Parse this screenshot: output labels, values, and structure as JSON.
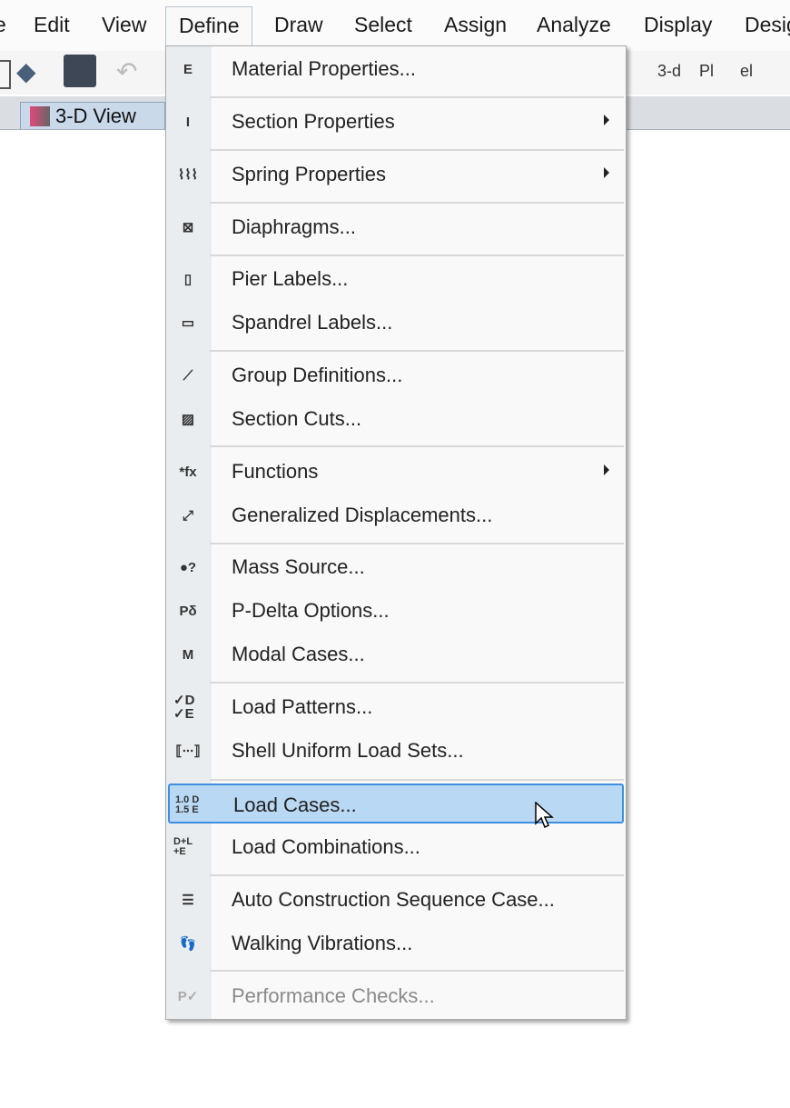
{
  "menubar": [
    "e",
    "Edit",
    "View",
    "Define",
    "Draw",
    "Select",
    "Assign",
    "Analyze",
    "Display",
    "Desig"
  ],
  "toolbar": {
    "view_3d": "3-d",
    "plan": "Pl",
    "elev": "el"
  },
  "tab": {
    "label": "3-D View"
  },
  "define_menu": {
    "items": [
      {
        "label": "Material Properties...",
        "icon": "material-icon",
        "glyph": "E"
      },
      {
        "label": "Section Properties",
        "icon": "section-icon",
        "glyph": "I",
        "submenu": true
      },
      {
        "label": "Spring Properties",
        "icon": "spring-icon",
        "glyph": "⌇⌇⌇",
        "submenu": true
      },
      {
        "label": "Diaphragms...",
        "icon": "diaphragm-icon",
        "glyph": "⊠"
      },
      {
        "label": "Pier Labels...",
        "icon": "pier-icon",
        "glyph": "▯"
      },
      {
        "label": "Spandrel Labels...",
        "icon": "spandrel-icon",
        "glyph": "▭"
      },
      {
        "label": "Group Definitions...",
        "icon": "group-icon",
        "glyph": "⟋"
      },
      {
        "label": "Section Cuts...",
        "icon": "section-cut-icon",
        "glyph": "▨"
      },
      {
        "label": "Functions",
        "icon": "functions-icon",
        "glyph": "*fx",
        "submenu": true
      },
      {
        "label": "Generalized Displacements...",
        "icon": "displacement-icon",
        "glyph": "⤢"
      },
      {
        "label": "Mass Source...",
        "icon": "mass-icon",
        "glyph": "●?"
      },
      {
        "label": "P-Delta Options...",
        "icon": "pdelta-icon",
        "glyph": "Pδ"
      },
      {
        "label": "Modal Cases...",
        "icon": "modal-icon",
        "glyph": "M"
      },
      {
        "label": "Load Patterns...",
        "icon": "load-patterns-icon",
        "glyph": "✓D ✓E"
      },
      {
        "label": "Shell Uniform Load Sets...",
        "icon": "shell-load-icon",
        "glyph": "⟦∙∙∙⟧"
      },
      {
        "label": "Load Cases...",
        "icon": "load-cases-icon",
        "glyph": "1.0 D 1.5 E",
        "highlighted": true
      },
      {
        "label": "Load Combinations...",
        "icon": "load-combinations-icon",
        "glyph": "D+L +E"
      },
      {
        "label": "Auto Construction Sequence Case...",
        "icon": "construction-icon",
        "glyph": "☰"
      },
      {
        "label": "Walking Vibrations...",
        "icon": "footsteps-icon",
        "glyph": "👣"
      },
      {
        "label": "Performance Checks...",
        "icon": "performance-icon",
        "glyph": "P✓",
        "disabled": true
      }
    ]
  },
  "colors": {
    "highlight": "#b9d8f3",
    "highlight_border": "#3d8fe0",
    "icon_column": "#e9edf0"
  }
}
